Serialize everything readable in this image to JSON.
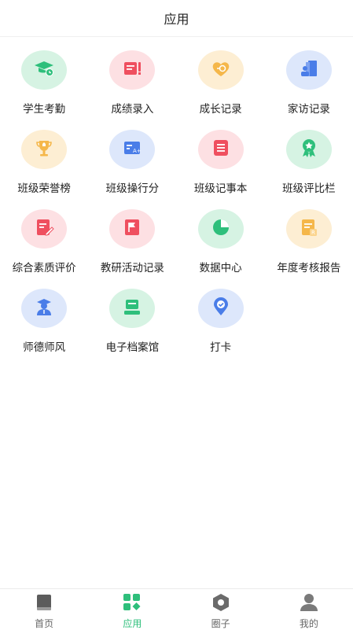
{
  "header": {
    "title": "应用"
  },
  "apps": [
    {
      "label": "学生考勤",
      "icon": "graduation-cap-clock-icon",
      "bg": "#d6f3e3",
      "fg": "#2ebf7b"
    },
    {
      "label": "成绩录入",
      "icon": "grade-entry-icon",
      "bg": "#fde0e3",
      "fg": "#ef4f5f"
    },
    {
      "label": "成长记录",
      "icon": "heart-growth-icon",
      "bg": "#fdeed3",
      "fg": "#f5b74a"
    },
    {
      "label": "家访记录",
      "icon": "home-visit-icon",
      "bg": "#dde7fb",
      "fg": "#4a7de8"
    },
    {
      "label": "班级荣誉榜",
      "icon": "trophy-icon",
      "bg": "#fdeed3",
      "fg": "#f5b74a"
    },
    {
      "label": "班级操行分",
      "icon": "conduct-score-icon",
      "bg": "#dde7fb",
      "fg": "#4a7de8"
    },
    {
      "label": "班级记事本",
      "icon": "notebook-icon",
      "bg": "#fde0e3",
      "fg": "#ef4f5f"
    },
    {
      "label": "班级评比栏",
      "icon": "award-badge-icon",
      "bg": "#d6f3e3",
      "fg": "#2ebf7b"
    },
    {
      "label": "综合素质评价",
      "icon": "edit-document-icon",
      "bg": "#fde0e3",
      "fg": "#ef4f5f"
    },
    {
      "label": "教研活动记录",
      "icon": "flag-document-icon",
      "bg": "#fde0e3",
      "fg": "#ef4f5f"
    },
    {
      "label": "数据中心",
      "icon": "pie-chart-icon",
      "bg": "#d6f3e3",
      "fg": "#2ebf7b"
    },
    {
      "label": "年度考核报告",
      "icon": "report-icon",
      "bg": "#fdeed3",
      "fg": "#f5b74a"
    },
    {
      "label": "师德师风",
      "icon": "teacher-icon",
      "bg": "#dde7fb",
      "fg": "#4a7de8"
    },
    {
      "label": "电子档案馆",
      "icon": "archive-icon",
      "bg": "#d6f3e3",
      "fg": "#2ebf7b"
    },
    {
      "label": "打卡",
      "icon": "location-check-icon",
      "bg": "#dde7fb",
      "fg": "#4a7de8"
    }
  ],
  "tabs": [
    {
      "label": "首页",
      "icon": "book-icon",
      "active": false
    },
    {
      "label": "应用",
      "icon": "apps-grid-icon",
      "active": true
    },
    {
      "label": "圈子",
      "icon": "hexagon-icon",
      "active": false
    },
    {
      "label": "我的",
      "icon": "person-icon",
      "active": false
    }
  ],
  "colors": {
    "accent": "#2ebf7b",
    "inactive": "#666666"
  }
}
